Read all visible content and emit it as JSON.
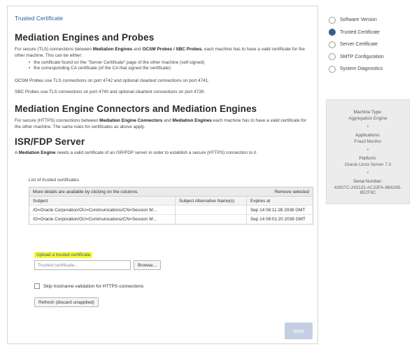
{
  "breadcrumb": "Trusted Certificate",
  "section1": {
    "title": "Mediation Engines and Probes",
    "intro_pre": "For secure (TLS) connections between ",
    "intro_b1": "Mediation Engines",
    "intro_mid1": " and ",
    "intro_b2": "OCSM Probes / SBC Probes",
    "intro_post": ", each machine has to have a valid certificate for the other machine. This can be either:",
    "bullets": [
      "the certificate found on the \"Server Certificate\" page of the other machine (self-signed)",
      "the corresponding CA certificate (of the CA that signed the certificate)"
    ],
    "note1": "OCSM Probes use TLS connections on port 4742 and optional cleartext connections on port 4741.",
    "note2": "SBC Probes use TLS connections on port 4740 and optional cleartext connections on port 4739."
  },
  "section2": {
    "title": "Mediation Engine Connectors and Mediation Engines",
    "text_pre": "For secure (HTTPS) connections between ",
    "text_b1": "Mediation Engine Connectors",
    "text_mid": " and ",
    "text_b2": "Mediation Engines",
    "text_post": " each machine has to have a valid certificate for the other machine. The same rules for certificates as above apply."
  },
  "section3": {
    "title": "ISR/FDP Server",
    "text_pre": "A ",
    "text_b": "Mediation Engine",
    "text_post": " needs a valid certificate of an ISR/FDP server in order to establish a secure (HTTPS) connection to it."
  },
  "cert_list": {
    "label": "List of trusted certificates",
    "hint": "More details are available by clicking on the columns.",
    "remove_label": "Remove selected",
    "columns": [
      "Subject",
      "Subject Alternative Name(s)",
      "Expires at"
    ],
    "rows": [
      {
        "subject": "/O=Oracle Corporation/OU=Communications/CN=Session M...",
        "san": "",
        "expires": "Sep 14 06:11:28 2038 GMT"
      },
      {
        "subject": "/O=Oracle Corporation/OU=Communications/CN=Session M...",
        "san": "",
        "expires": "Sep 14 06:01:20 2038 GMT"
      }
    ]
  },
  "upload": {
    "link": "Upload a trusted certificate",
    "placeholder": "Trusted certificate...",
    "browse": "Browse..."
  },
  "skip_label": "Skip hostname validation for HTTPS connections",
  "refresh_label": "Refresh (discard unapplied)",
  "apply_label": "apply",
  "nav": {
    "items": [
      {
        "label": "Software Version",
        "selected": false
      },
      {
        "label": "Trusted Certificate",
        "selected": true
      },
      {
        "label": "Server Certificate",
        "selected": false
      },
      {
        "label": "SMTP Configuration",
        "selected": false
      },
      {
        "label": "System Diagnostics",
        "selected": false
      }
    ]
  },
  "info": {
    "machine_type_label": "Machine Type:",
    "machine_type": "Aggregation Engine",
    "applications_label": "Applications:",
    "applications": "Fraud Monitor",
    "platform_label": "Platform:",
    "platform": "Oracle Linux Server 7.3",
    "serial_label": "Serial Number:",
    "serial_line1": "43007C-243132-AC33FA-9B4295-",
    "serial_line2": "8E2F8C",
    "separator": "•"
  },
  "colors": {
    "accent": "#2b5d9c",
    "radio_selected": "#3b5a91",
    "highlight": "#fbf737",
    "apply_disabled": "#c5cfe3"
  }
}
